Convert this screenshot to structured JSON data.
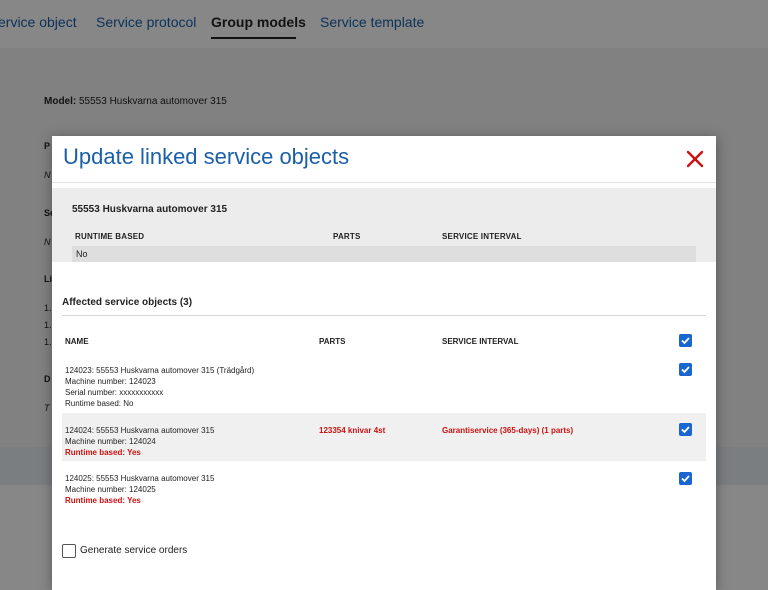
{
  "background": {
    "tabs": [
      {
        "label": "ervice object"
      },
      {
        "label": "Service protocol"
      },
      {
        "label": "Group models"
      },
      {
        "label": "Service template"
      }
    ],
    "model_label": "Model:",
    "model_value": "55553 Huskvarna automover 315",
    "fragments": [
      "P",
      "N",
      "Se",
      "N",
      "Li",
      "1.",
      "1.",
      "1.",
      "D",
      "T"
    ]
  },
  "modal": {
    "title": "Update linked service objects",
    "close_icon": "close-icon",
    "summary": {
      "model": "55553 Huskvarna automover 315",
      "headers": {
        "runtime": "RUNTIME BASED",
        "parts": "PARTS",
        "interval": "SERVICE INTERVAL"
      },
      "runtime_value": "No"
    },
    "affected_title": "Affected service objects (3)",
    "columns": {
      "name": "NAME",
      "parts": "PARTS",
      "interval": "SERVICE INTERVAL"
    },
    "select_all_checked": true,
    "objects": [
      {
        "lines": [
          "124023: 55553 Huskvarna automover 315 (Trädgård)",
          "Machine number: 124023",
          "Serial number: xxxxxxxxxxx",
          "Runtime based: No"
        ],
        "parts": "",
        "interval": "",
        "runtime_highlight": false,
        "checked": true
      },
      {
        "lines": [
          "124024: 55553 Huskvarna automover 315",
          "Machine number: 124024",
          "Runtime based: Yes"
        ],
        "parts": "123354 knivar 4st",
        "interval": "Garantiservice (365-days) (1 parts)",
        "runtime_highlight": true,
        "checked": true
      },
      {
        "lines": [
          "124025: 55553 Huskvarna automover 315",
          "Machine number: 124025",
          "Runtime based: Yes"
        ],
        "parts": "",
        "interval": "",
        "runtime_highlight": true,
        "checked": true
      }
    ],
    "generate_label": "Generate service orders",
    "generate_checked": false
  },
  "colors": {
    "accent": "#1a5fa8",
    "checkbox": "#1a66d1",
    "warning": "#cc1111"
  }
}
